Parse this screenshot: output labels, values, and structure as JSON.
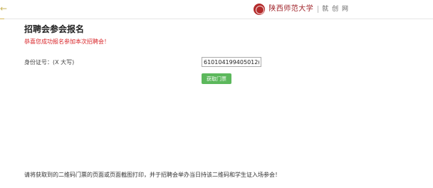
{
  "header": {
    "logo_text": "陕西师范大学",
    "site_name": "就 创 网"
  },
  "form": {
    "title": "招聘会参会报名",
    "success_message": "恭喜您成功报名参加本次招聘会！",
    "id_label": "身份证号：(X 大写)",
    "id_value": "610104199405012(",
    "get_ticket_label": "获取门票"
  },
  "footer": {
    "note": "请将获取到的二维码门票的页面或页面截图打印，并于招聘会举办当日持该二维码和学生证入场参会！"
  },
  "colors": {
    "accent_green": "#5cb85c",
    "message_red": "#d9262a",
    "logo_red": "#a0242a"
  },
  "icons": {
    "back": "back-arrow-icon",
    "seal": "university-seal-icon"
  }
}
